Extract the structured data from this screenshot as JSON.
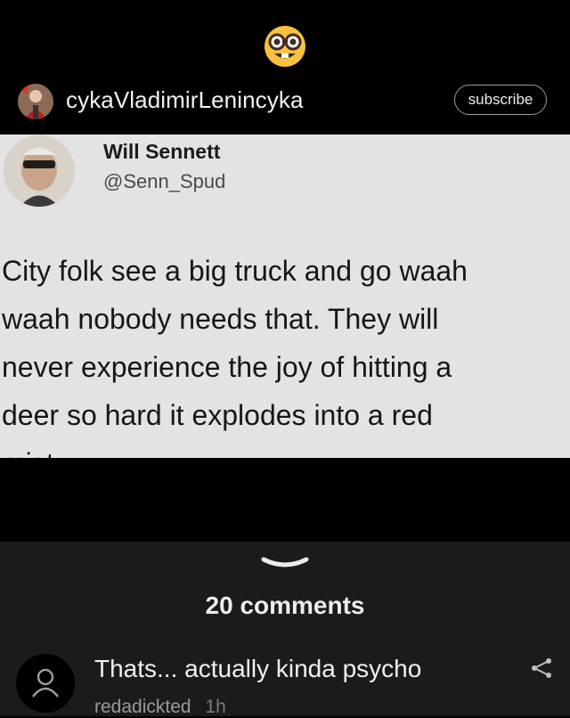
{
  "header": {
    "emoji": "nerd-face-emoji"
  },
  "post": {
    "username": "cykaVladimirLenincyka",
    "subscribe_label": "subscribe"
  },
  "tweet": {
    "name": "Will Sennett",
    "handle": "@Senn_Spud",
    "text": "City folk see a big truck and go waah\nwaah nobody needs that. They will\nnever experience the joy of hitting a\ndeer so hard it explodes into a red\nmist"
  },
  "comments": {
    "count_label": "20 comments",
    "items": [
      {
        "text": "Thats... actually kinda psycho",
        "author": "redadickted",
        "time": "1h"
      }
    ]
  },
  "colors": {
    "background": "#000000",
    "panel": "#1a1b1f",
    "tweet_bg": "#e3e3e3",
    "emoji_yellow": "#f9c23c"
  }
}
